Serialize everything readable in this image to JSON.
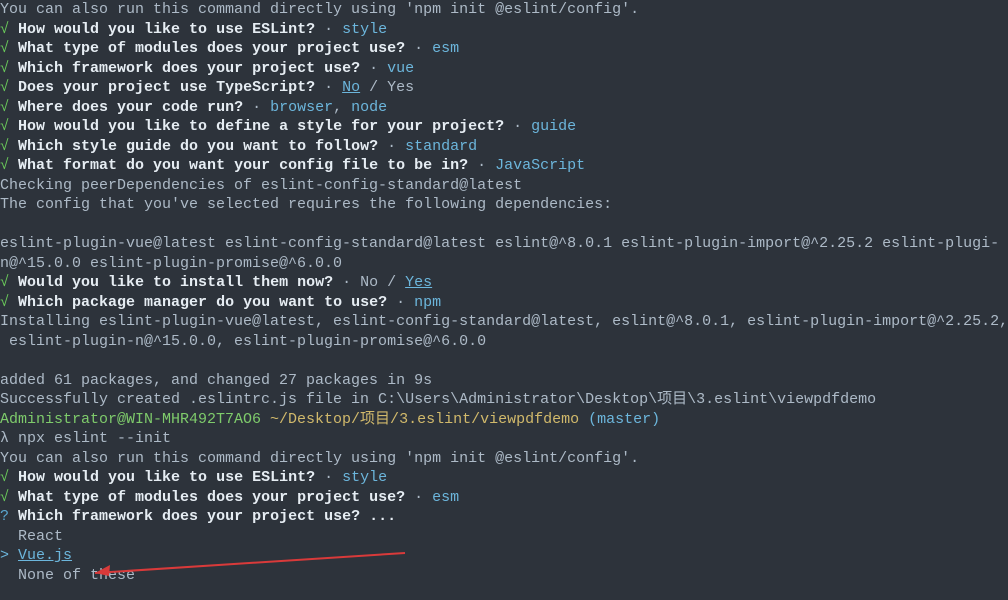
{
  "top_note": "You can also run this command directly using 'npm init @eslint/config'.",
  "check": "√",
  "qmark": "?",
  "sep": " · ",
  "q1": {
    "text": "How would you like to use ESLint?",
    "ans": "style"
  },
  "q2": {
    "text": "What type of modules does your project use?",
    "ans": "esm"
  },
  "q3": {
    "text": "Which framework does your project use?",
    "ans": "vue"
  },
  "q4": {
    "text": "Does your project use TypeScript?",
    "ans": "No",
    "rest": " / Yes"
  },
  "q5": {
    "text": "Where does your code run?",
    "ans1": "browser",
    "comma": ", ",
    "ans2": "node"
  },
  "q6": {
    "text": "How would you like to define a style for your project?",
    "ans": "guide"
  },
  "q7": {
    "text": "Which style guide do you want to follow?",
    "ans": "standard"
  },
  "q8": {
    "text": "What format do you want your config file to be in?",
    "ans": "JavaScript"
  },
  "checking": "Checking peerDependencies of eslint-config-standard@latest",
  "config_requires": "The config that you've selected requires the following dependencies:",
  "deps1": "eslint-plugin-vue@latest eslint-config-standard@latest eslint@^8.0.1 eslint-plugin-import@^2.25.2 eslint-plugi-",
  "deps2": "n@^15.0.0 eslint-plugin-promise@^6.0.0",
  "install_q": {
    "text": "Would you like to install them now?",
    "pre": "No / ",
    "ans": "Yes"
  },
  "pm_q": {
    "text": "Which package manager do you want to use?",
    "ans": "npm"
  },
  "installing1": "Installing eslint-plugin-vue@latest, eslint-config-standard@latest, eslint@^8.0.1, eslint-plugin-import@^2.25.2,",
  "installing2": " eslint-plugin-n@^15.0.0, eslint-plugin-promise@^6.0.0",
  "added": "added 61 packages, and changed 27 packages in 9s",
  "created": "Successfully created .eslintrc.js file in C:\\Users\\Administrator\\Desktop\\项目\\3.eslint\\viewpdfdemo",
  "prompt_user": "Administrator@WIN-MHR492T7AO6 ",
  "prompt_path": "~/Desktop/项目/3.eslint/viewpdfdemo ",
  "prompt_branch": "(master)",
  "cmd_prefix": "λ ",
  "cmd": "npx eslint --init",
  "second_note": "You can also run this command directly using 'npm init @eslint/config'.",
  "sq1": {
    "text": "How would you like to use ESLint?",
    "ans": "style"
  },
  "sq2": {
    "text": "What type of modules does your project use?",
    "ans": "esm"
  },
  "sq3": {
    "text": "Which framework does your project use?",
    "dots": " ..."
  },
  "options": {
    "react": "  React",
    "ptr": "> ",
    "vue": "Vue.js",
    "none": "  None of these"
  }
}
